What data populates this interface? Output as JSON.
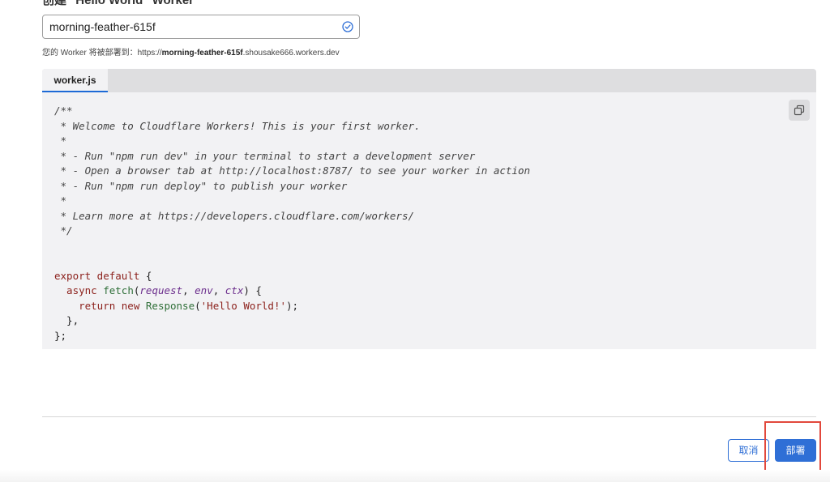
{
  "heading": "创建 \"Hello World\" Worker",
  "worker_name": {
    "value": "morning-feather-615f",
    "valid_icon": "check-circle-icon"
  },
  "deploy_hint": {
    "prefix": "您的 Worker 将被部署到：https://",
    "name": "morning-feather-615f",
    "suffix": ".shousake666.workers.dev"
  },
  "editor": {
    "tab_label": "worker.js",
    "copy_icon": "copy-icon",
    "code_lines": [
      [
        {
          "t": "/**",
          "c": "cm"
        }
      ],
      [
        {
          "t": " * Welcome to Cloudflare Workers! This is your first worker.",
          "c": "cm"
        }
      ],
      [
        {
          "t": " *",
          "c": "cm"
        }
      ],
      [
        {
          "t": " * - Run \"npm run dev\" in your terminal to start a development server",
          "c": "cm"
        }
      ],
      [
        {
          "t": " * - Open a browser tab at http://localhost:8787/ to see your worker in action",
          "c": "cm"
        }
      ],
      [
        {
          "t": " * - Run \"npm run deploy\" to publish your worker",
          "c": "cm"
        }
      ],
      [
        {
          "t": " *",
          "c": "cm"
        }
      ],
      [
        {
          "t": " * Learn more at https://developers.cloudflare.com/workers/",
          "c": "cm"
        }
      ],
      [
        {
          "t": " */",
          "c": "cm"
        }
      ],
      [],
      [],
      [
        {
          "t": "export default",
          "c": "kw"
        },
        {
          "t": " {",
          "c": "pl"
        }
      ],
      [
        {
          "t": "  async ",
          "c": "kw"
        },
        {
          "t": "fetch",
          "c": "fn"
        },
        {
          "t": "(",
          "c": "pl"
        },
        {
          "t": "request",
          "c": "pr"
        },
        {
          "t": ", ",
          "c": "pl"
        },
        {
          "t": "env",
          "c": "pr"
        },
        {
          "t": ", ",
          "c": "pl"
        },
        {
          "t": "ctx",
          "c": "pr"
        },
        {
          "t": ") {",
          "c": "pl"
        }
      ],
      [
        {
          "t": "    return new ",
          "c": "kw"
        },
        {
          "t": "Response",
          "c": "fn"
        },
        {
          "t": "(",
          "c": "pl"
        },
        {
          "t": "'Hello World!'",
          "c": "st"
        },
        {
          "t": ");",
          "c": "pl"
        }
      ],
      [
        {
          "t": "  },",
          "c": "pl"
        }
      ],
      [
        {
          "t": "};",
          "c": "pl"
        }
      ]
    ]
  },
  "actions": {
    "cancel_label": "取消",
    "deploy_label": "部署"
  },
  "colors": {
    "accent": "#2f6fd6",
    "highlight": "#e2483c"
  }
}
